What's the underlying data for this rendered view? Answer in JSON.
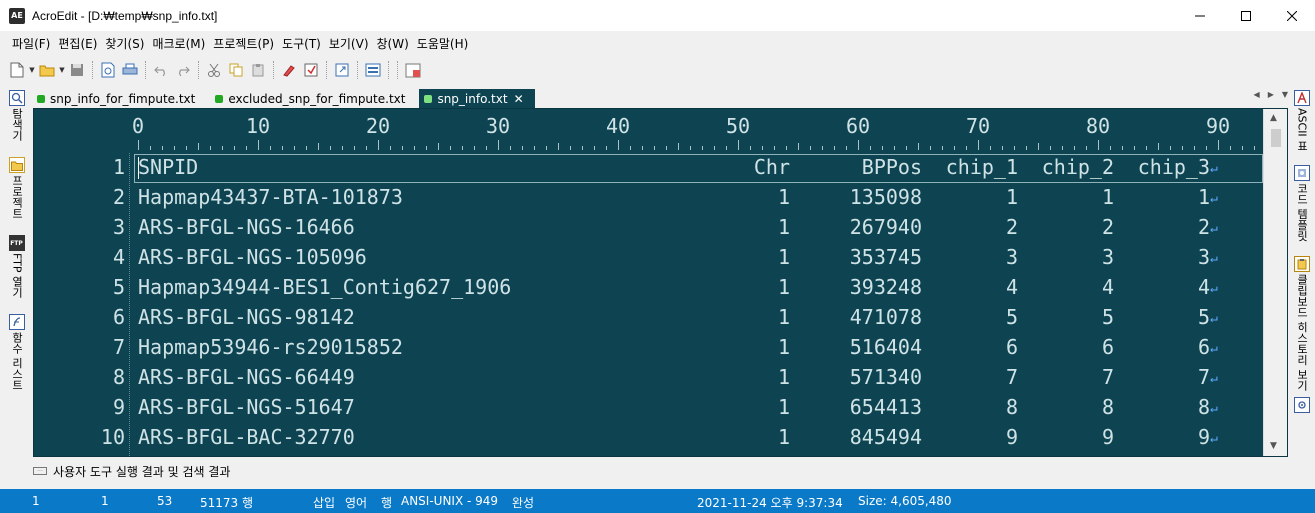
{
  "window": {
    "title": "AcroEdit - [D:₩temp₩snp_info.txt]",
    "app_icon_text": "AE"
  },
  "menu": [
    "파일(F)",
    "편집(E)",
    "찾기(S)",
    "매크로(M)",
    "프로젝트(P)",
    "도구(T)",
    "보기(V)",
    "창(W)",
    "도움말(H)"
  ],
  "side_left": [
    {
      "label": "탐색기",
      "icon": "explorer-icon"
    },
    {
      "label": "프로젝트",
      "icon": "project-icon"
    },
    {
      "label": "FTP 열기",
      "icon": "ftp-icon",
      "icon_text": "FTP"
    },
    {
      "label": "함수 리스트",
      "icon": "function-list-icon"
    }
  ],
  "side_right": [
    {
      "label": "ASCII 표",
      "icon": "ascii-icon"
    },
    {
      "label": "코드 템플릿",
      "icon": "template-icon"
    },
    {
      "label": "클립보드 히스토리 보기",
      "icon": "clipboard-icon"
    }
  ],
  "tabs": [
    {
      "label": "snp_info_for_fimpute.txt",
      "active": false
    },
    {
      "label": "excluded_snp_for_fimpute.txt",
      "active": false
    },
    {
      "label": "snp_info.txt",
      "active": true
    }
  ],
  "ruler": [
    "0",
    "10",
    "20",
    "30",
    "40",
    "50",
    "60",
    "70",
    "80",
    "90"
  ],
  "lines": [
    {
      "num": "1",
      "snp": "SNPID",
      "chr": "Chr",
      "bp": "BPPos",
      "c1": "chip_1",
      "c2": "chip_2",
      "c3": "chip_3"
    },
    {
      "num": "2",
      "snp": "Hapmap43437-BTA-101873",
      "chr": "1",
      "bp": "135098",
      "c1": "1",
      "c2": "1",
      "c3": "1"
    },
    {
      "num": "3",
      "snp": "ARS-BFGL-NGS-16466",
      "chr": "1",
      "bp": "267940",
      "c1": "2",
      "c2": "2",
      "c3": "2"
    },
    {
      "num": "4",
      "snp": "ARS-BFGL-NGS-105096",
      "chr": "1",
      "bp": "353745",
      "c1": "3",
      "c2": "3",
      "c3": "3"
    },
    {
      "num": "5",
      "snp": "Hapmap34944-BES1_Contig627_1906",
      "chr": "1",
      "bp": "393248",
      "c1": "4",
      "c2": "4",
      "c3": "4"
    },
    {
      "num": "6",
      "snp": "ARS-BFGL-NGS-98142",
      "chr": "1",
      "bp": "471078",
      "c1": "5",
      "c2": "5",
      "c3": "5"
    },
    {
      "num": "7",
      "snp": "Hapmap53946-rs29015852",
      "chr": "1",
      "bp": "516404",
      "c1": "6",
      "c2": "6",
      "c3": "6"
    },
    {
      "num": "8",
      "snp": "ARS-BFGL-NGS-66449",
      "chr": "1",
      "bp": "571340",
      "c1": "7",
      "c2": "7",
      "c3": "7"
    },
    {
      "num": "9",
      "snp": "ARS-BFGL-NGS-51647",
      "chr": "1",
      "bp": "654413",
      "c1": "8",
      "c2": "8",
      "c3": "8"
    },
    {
      "num": "10",
      "snp": "ARS-BFGL-BAC-32770",
      "chr": "1",
      "bp": "845494",
      "c1": "9",
      "c2": "9",
      "c3": "9"
    }
  ],
  "eol_symbol": "↵",
  "output_panel": {
    "label": "사용자 도구 실행 결과 및 검색 결과"
  },
  "status": {
    "line": "1",
    "col": "1",
    "pos": "53",
    "lines": "51173 행",
    "insert": "삽입",
    "lang": "영어",
    "mode": "행",
    "encoding": "ANSI-UNIX - 949",
    "state": "완성",
    "datetime": "2021-11-24 오후 9:37:34",
    "size": "Size: 4,605,480"
  },
  "colors": {
    "editor_bg": "#0e4452",
    "editor_text": "#cfe3e6",
    "status_bg": "#0a7ac8",
    "eol": "#5ea9ff"
  }
}
